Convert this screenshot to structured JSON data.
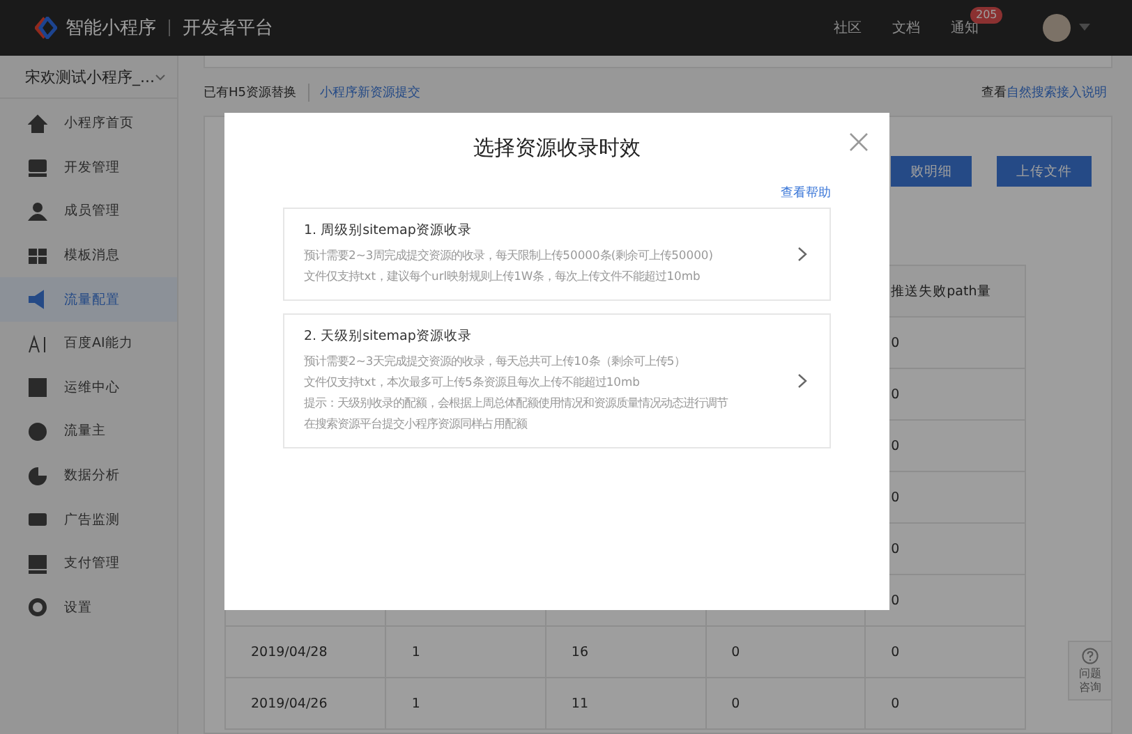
{
  "topbar": {
    "logo_text": "智能小程序",
    "platform": "开发者平台",
    "links": [
      {
        "label": "社区"
      },
      {
        "label": "文档"
      },
      {
        "label": "通知",
        "badge": "205"
      }
    ]
  },
  "sidebar": {
    "app_name": "宋欢测试小程序_...",
    "items": [
      {
        "label": "小程序首页",
        "selected": false
      },
      {
        "label": "开发管理",
        "selected": false
      },
      {
        "label": "成员管理",
        "selected": false
      },
      {
        "label": "模板消息",
        "selected": false
      },
      {
        "label": "流量配置",
        "selected": true
      },
      {
        "label": "百度AI能力",
        "selected": false
      },
      {
        "label": "运维中心",
        "selected": false
      },
      {
        "label": "流量主",
        "selected": false
      },
      {
        "label": "数据分析",
        "selected": false
      },
      {
        "label": "广告监测",
        "selected": false
      },
      {
        "label": "支付管理",
        "selected": false
      },
      {
        "label": "设置",
        "selected": false
      }
    ]
  },
  "tabs": [
    {
      "label": "已有H5资源替换",
      "selected": false
    },
    {
      "label": "小程序新资源提交",
      "selected": true
    }
  ],
  "doc_link": {
    "prefix": "查看",
    "link": "自然搜索接入说明"
  },
  "buttons": [
    "败明细",
    "上传文件"
  ],
  "table": {
    "header": {
      "column_5": "推送失败path量"
    },
    "rows": [
      {
        "column_5": "0"
      },
      {
        "column_5": "0"
      },
      {
        "column_5": "0"
      },
      {
        "column_5": "0"
      },
      {
        "column_5": "0"
      },
      {
        "column_5": "0"
      },
      {
        "column_1": "2019/04/28",
        "column_2": "1",
        "column_3": "16",
        "column_4": "0",
        "column_5": "0"
      },
      {
        "column_1": "2019/04/26",
        "column_2": "1",
        "column_3": "11",
        "column_4": "0",
        "column_5": "0"
      }
    ]
  },
  "help_widget": "问题咨询",
  "modal": {
    "title": "选择资源收录时效",
    "help_link": "查看帮助",
    "options": [
      {
        "title": "1. 周级别sitemap资源收录",
        "lines": [
          "预计需要2~3周完成提交资源的收录，每天限制上传50000条(剩余可上传50000)",
          "文件仅支持txt，建议每个url映射规则上传1W条，每次上传文件不能超过10mb"
        ]
      },
      {
        "title": "2. 天级别sitemap资源收录",
        "lines": [
          "预计需要2~3天完成提交资源的收录，每天总共可上传10条（剩余可上传5）",
          "文件仅支持txt，本次最多可上传5条资源且每次上传不能超过10mb",
          "提示：天级别收录的配额，会根据上周总体配额使用情况和资源质量情况动态进行调节",
          "在搜索资源平台提交小程序资源同样占用配额"
        ]
      }
    ]
  }
}
